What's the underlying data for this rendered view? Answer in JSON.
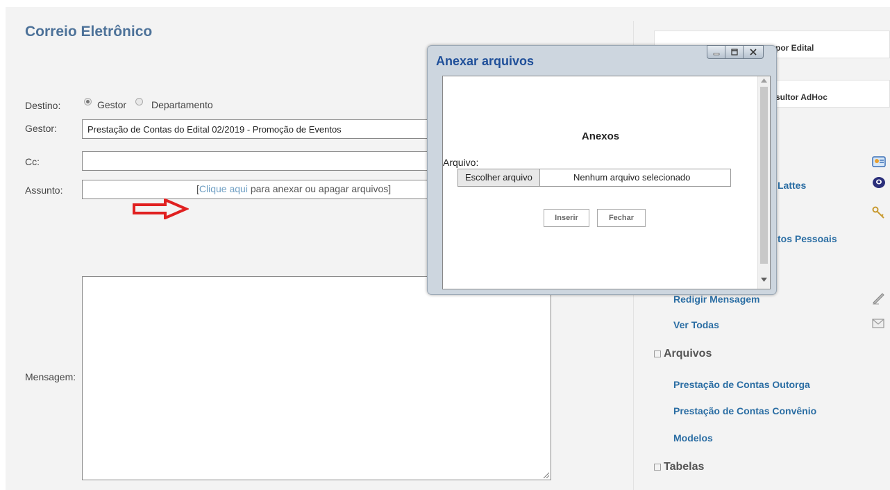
{
  "page": {
    "title": "Correio Eletrônico",
    "destino_label": "Destino:",
    "destino_options": [
      "Gestor",
      "Departamento"
    ],
    "gestor_label": "Gestor:",
    "gestor_value": "Prestação de Contas do Edital 02/2019 - Promoção de Eventos",
    "cc_label": "Cc:",
    "cc_value": "",
    "assunto_label": "Assunto:",
    "assunto_value": "",
    "attach_link": {
      "open": "[",
      "link": "Clique aqui",
      "rest": " para anexar ou apagar arquivos]"
    },
    "mensagem_label": "Mensagem:",
    "mensagem_value": ""
  },
  "sidebar": {
    "boxes": [
      "por Edital",
      "sultor AdHoc"
    ],
    "links_top": [
      "Lattes",
      "tos Pessoais"
    ],
    "mensagens": [
      "Redigir Mensagem",
      "Ver Todas"
    ],
    "arquivos_title": "Arquivos",
    "arquivos": [
      "Prestação de Contas Outorga",
      "Prestação de Contas Convênio",
      "Modelos"
    ],
    "tabelas_title": "Tabelas"
  },
  "modal": {
    "title": "Anexar arquivos",
    "heading": "Anexos",
    "arquivo_label": "Arquivo:",
    "file_button": "Escolher arquivo",
    "file_status": "Nenhum arquivo selecionado",
    "insert_button": "Inserir",
    "close_button": "Fechar"
  },
  "annotations": {
    "arrow_color": "#e02020"
  }
}
